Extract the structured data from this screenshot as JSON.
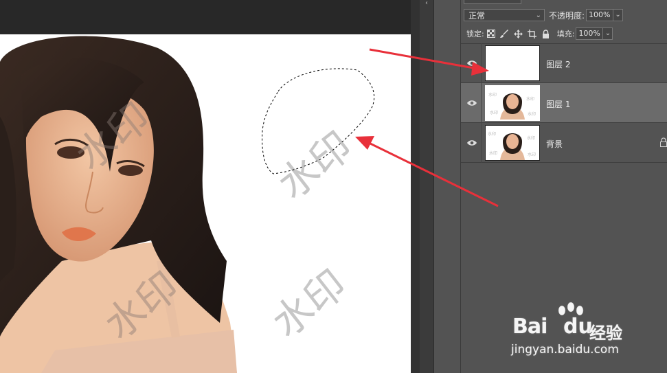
{
  "layers_panel": {
    "blend_mode": "正常",
    "opacity_label": "不透明度:",
    "opacity_value": "100%",
    "lock_label": "锁定:",
    "fill_label": "填充:",
    "fill_value": "100%",
    "layers": [
      {
        "name": "图层 2",
        "selected": false,
        "type": "transparent"
      },
      {
        "name": "图层 1",
        "selected": true,
        "type": "photo"
      },
      {
        "name": "背景",
        "selected": false,
        "type": "photo",
        "locked": true
      }
    ]
  },
  "canvas": {
    "watermark_text_1": "水印",
    "watermark_text_2": "水印",
    "watermark_text_3": "水印",
    "watermark_text_4": "水印"
  },
  "site_watermark": {
    "brand_bai": "Bai",
    "brand_du": "du",
    "brand_jingyan": "经验",
    "url": "jingyan.baidu.com"
  },
  "colors": {
    "panel_bg": "#535353",
    "workspace_bg": "#282828",
    "selected_layer": "#6b6b6b",
    "arrow_red": "#e8303a"
  },
  "icons": [
    "eye-icon",
    "lock-transparent-icon",
    "brush-icon",
    "move-icon",
    "artboard-icon",
    "lock-all-icon",
    "chevron-down-icon",
    "layer-lock-icon"
  ]
}
